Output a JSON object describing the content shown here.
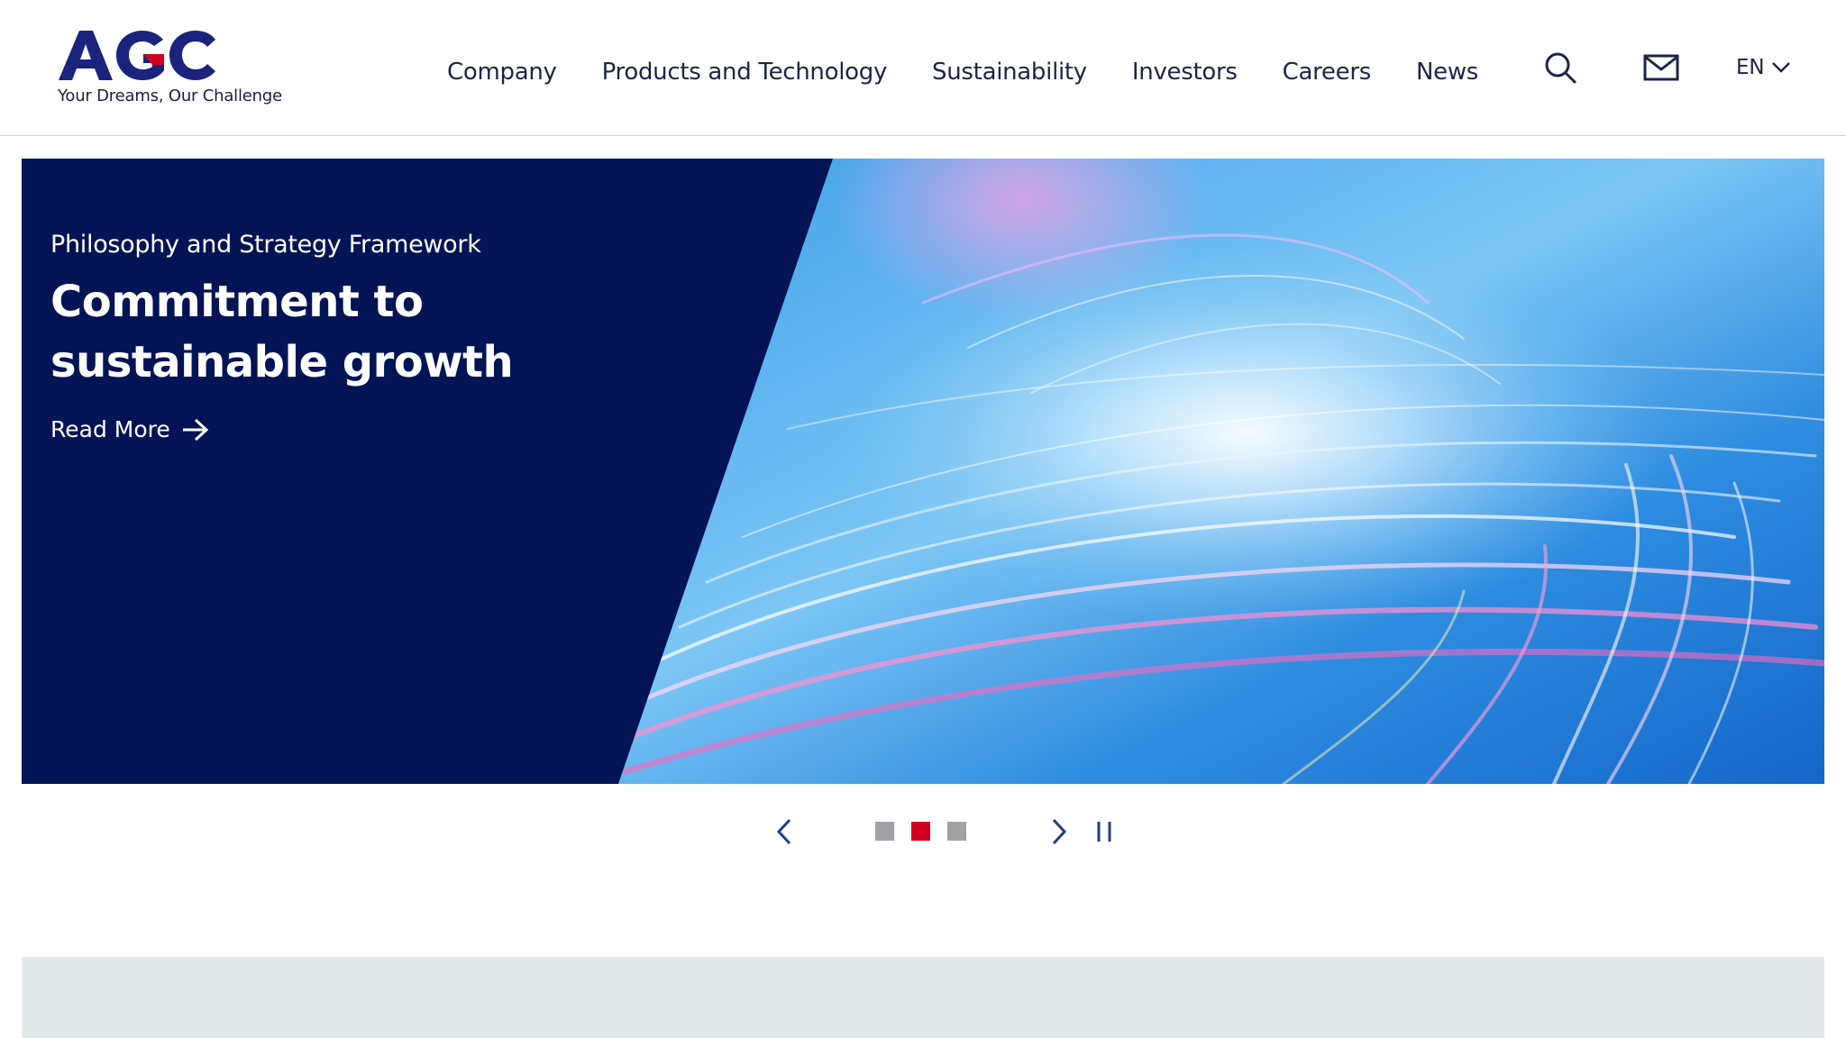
{
  "brand": {
    "name": "AGC",
    "tagline": "Your Dreams, Our Challenge",
    "colors": {
      "navy": "#1a237e",
      "accent_red": "#d1001f"
    }
  },
  "nav": {
    "items": [
      {
        "label": "Company"
      },
      {
        "label": "Products and Technology"
      },
      {
        "label": "Sustainability"
      },
      {
        "label": "Investors"
      },
      {
        "label": "Careers"
      },
      {
        "label": "News"
      }
    ]
  },
  "header_actions": {
    "search_icon": "search-icon",
    "contact_icon": "mail-icon",
    "language": {
      "label": "EN",
      "icon": "chevron-down-icon"
    }
  },
  "hero": {
    "eyebrow": "Philosophy and Strategy Framework",
    "title": "Commitment to sustainable growth",
    "link_label": "Read More",
    "colors": {
      "panel": "#021455"
    }
  },
  "carousel": {
    "slide_count": 3,
    "active_index": 2,
    "controls": [
      "chevron-left-icon",
      "chevron-right-icon",
      "pause-icon"
    ]
  }
}
